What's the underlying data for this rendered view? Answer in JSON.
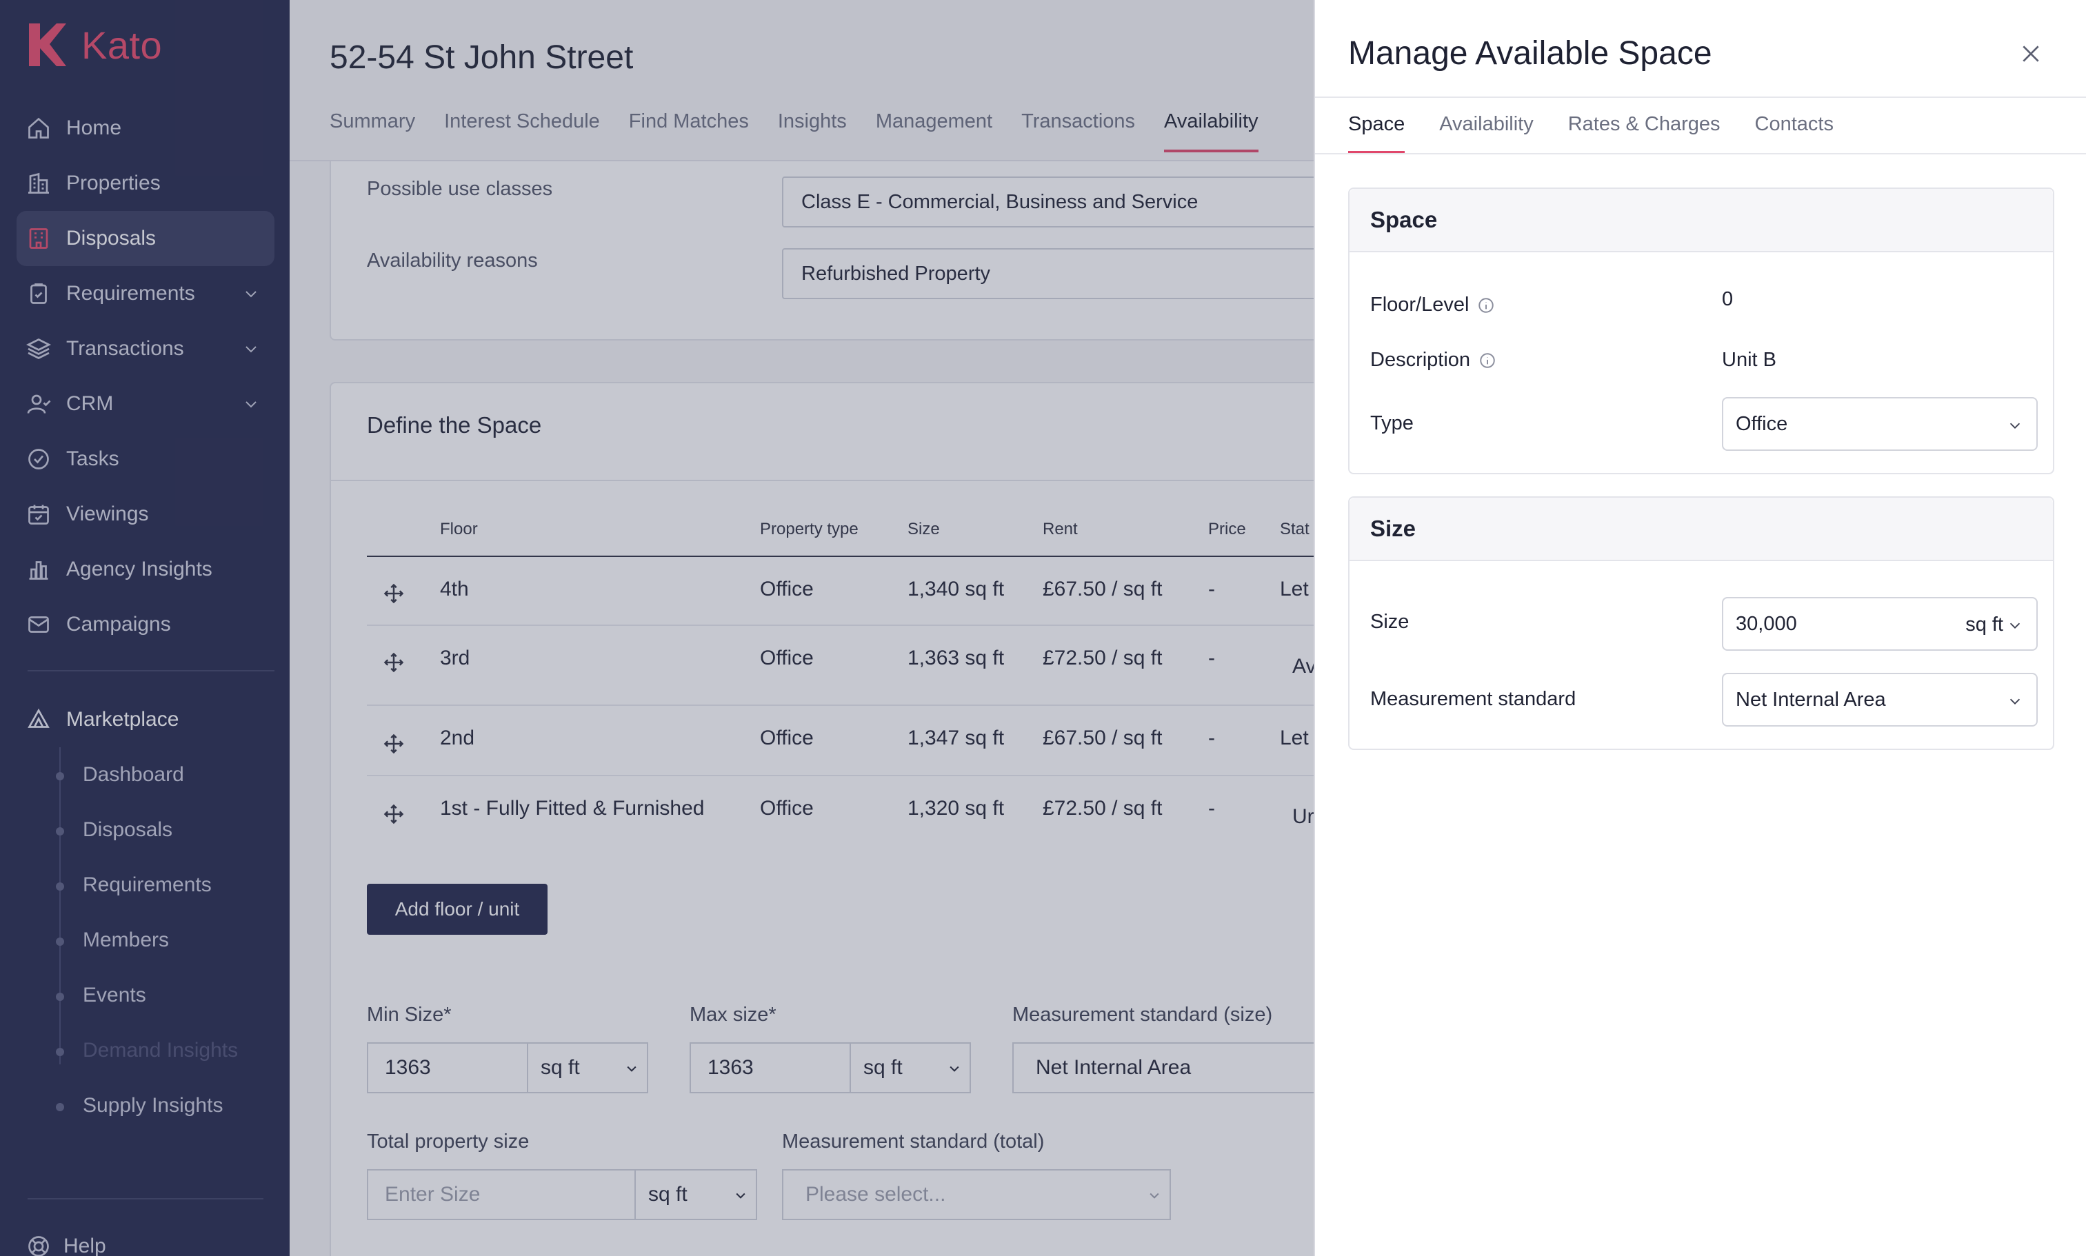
{
  "app": {
    "logo_text": "Kato",
    "brand_color": "#e84a6a",
    "sidebar_color": "#22264a"
  },
  "sidebar": {
    "items": [
      {
        "label": "Home",
        "icon": "home-icon"
      },
      {
        "label": "Properties",
        "icon": "building-icon"
      },
      {
        "label": "Disposals",
        "icon": "disposals-icon",
        "active": true
      },
      {
        "label": "Requirements",
        "icon": "clipboard-icon",
        "expandable": true
      },
      {
        "label": "Transactions",
        "icon": "layers-icon",
        "expandable": true
      },
      {
        "label": "CRM",
        "icon": "user-icon",
        "expandable": true
      },
      {
        "label": "Tasks",
        "icon": "check-circle-icon"
      },
      {
        "label": "Viewings",
        "icon": "calendar-icon"
      },
      {
        "label": "Agency Insights",
        "icon": "bar-chart-icon"
      },
      {
        "label": "Campaigns",
        "icon": "mail-icon"
      }
    ],
    "marketplace": {
      "label": "Marketplace",
      "subitems": [
        "Dashboard",
        "Disposals",
        "Requirements",
        "Members",
        "Events",
        "Demand Insights",
        "Supply Insights"
      ]
    },
    "help_label": "Help"
  },
  "main": {
    "title": "52-54 St John Street",
    "tabs": [
      "Summary",
      "Interest Schedule",
      "Find Matches",
      "Insights",
      "Management",
      "Transactions",
      "Availability"
    ],
    "active_tab": "Availability",
    "possible_use_classes_label": "Possible use classes",
    "possible_use_classes_value": "Class E - Commercial, Business and Service",
    "availability_reasons_label": "Availability reasons",
    "availability_reasons_value": "Refurbished Property",
    "define_space_title": "Define the Space",
    "table": {
      "headers": [
        "Floor",
        "Property type",
        "Size",
        "Rent",
        "Price",
        "Stat"
      ],
      "rows": [
        {
          "floor": "4th",
          "type": "Office",
          "size": "1,340 sq ft",
          "rent": "£67.50 / sq ft",
          "price": "-",
          "status": "Let"
        },
        {
          "floor": "3rd",
          "type": "Office",
          "size": "1,363 sq ft",
          "rent": "£72.50 / sq ft",
          "price": "-",
          "status": "Av"
        },
        {
          "floor": "2nd",
          "type": "Office",
          "size": "1,347 sq ft",
          "rent": "£67.50 / sq ft",
          "price": "-",
          "status": "Let"
        },
        {
          "floor": "1st - Fully Fitted & Furnished",
          "type": "Office",
          "size": "1,320 sq ft",
          "rent": "£72.50 / sq ft",
          "price": "-",
          "status": "Ur"
        }
      ]
    },
    "add_floor_label": "Add floor / unit",
    "min_size_label": "Min Size*",
    "min_size_value": "1363",
    "min_size_unit": "sq ft",
    "max_size_label": "Max size*",
    "max_size_value": "1363",
    "max_size_unit": "sq ft",
    "measurement_size_label": "Measurement standard (size)",
    "measurement_size_value": "Net Internal Area",
    "total_size_label": "Total property size",
    "total_size_placeholder": "Enter Size",
    "total_size_unit": "sq ft",
    "measurement_total_label": "Measurement standard (total)",
    "measurement_total_placeholder": "Please select..."
  },
  "drawer": {
    "title": "Manage Available Space",
    "tabs": [
      "Space",
      "Availability",
      "Rates & Charges",
      "Contacts"
    ],
    "active_tab": "Space",
    "space_section": {
      "title": "Space",
      "floor_label": "Floor/Level",
      "floor_value": "0",
      "description_label": "Description",
      "description_value": "Unit B",
      "type_label": "Type",
      "type_value": "Office"
    },
    "size_section": {
      "title": "Size",
      "size_label": "Size",
      "size_value": "30,000",
      "size_unit": "sq ft",
      "measurement_label": "Measurement standard",
      "measurement_value": "Net Internal Area"
    }
  }
}
